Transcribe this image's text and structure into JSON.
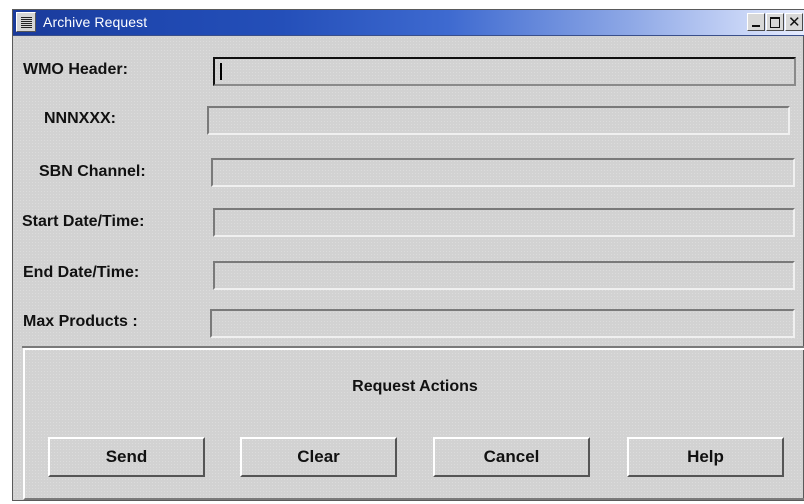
{
  "window": {
    "title": "Archive Request",
    "menu_icon": "window-menu-icon",
    "controls": {
      "minimize_icon": "minimize-icon",
      "maximize_icon": "maximize-icon",
      "close_glyph": "✕"
    }
  },
  "fields": {
    "wmo_header": {
      "label": "WMO Header:",
      "value": ""
    },
    "nnnxxx": {
      "label": "NNNXXX:",
      "value": ""
    },
    "sbn_channel": {
      "label": "SBN Channel:",
      "value": ""
    },
    "start_datetime": {
      "label": "Start Date/Time:",
      "value": ""
    },
    "end_datetime": {
      "label": "End Date/Time:",
      "value": ""
    },
    "max_products": {
      "label": "Max Products :",
      "value": ""
    }
  },
  "actions": {
    "title": "Request Actions",
    "send_label": "Send",
    "clear_label": "Clear",
    "cancel_label": "Cancel",
    "help_label": "Help"
  },
  "colors": {
    "titlebar_start": "#1a3a9a",
    "titlebar_end": "#e6ecff",
    "panel_background": "#d2d2d2"
  }
}
